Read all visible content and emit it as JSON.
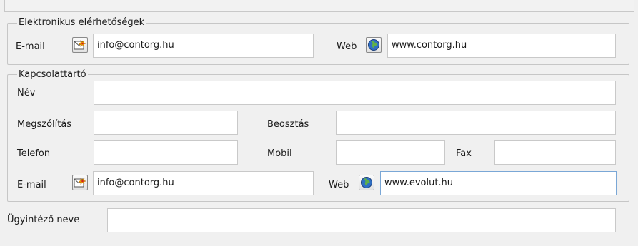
{
  "electronic": {
    "legend": "Elektronikus elérhetőségek",
    "email_label": "E-mail",
    "email_value": "info@contorg.hu",
    "web_label": "Web",
    "web_value": "www.contorg.hu"
  },
  "contact": {
    "legend": "Kapcsolattartó",
    "name_label": "Név",
    "name_value": "",
    "salutation_label": "Megszólítás",
    "salutation_value": "",
    "position_label": "Beosztás",
    "position_value": "",
    "phone_label": "Telefon",
    "phone_value": "",
    "mobile_label": "Mobil",
    "mobile_value": "",
    "fax_label": "Fax",
    "fax_value": "",
    "email_label": "E-mail",
    "email_value": "info@contorg.hu",
    "web_label": "Web",
    "web_value": "www.evolut.hu"
  },
  "agent": {
    "label": "Ügyintéző neve",
    "value": ""
  },
  "icons": {
    "email": "mail-icon",
    "web": "globe-icon"
  },
  "colors": {
    "background": "#f0f0f0",
    "focus_border": "#7aa7d6",
    "field_border": "#c9c9c9"
  }
}
